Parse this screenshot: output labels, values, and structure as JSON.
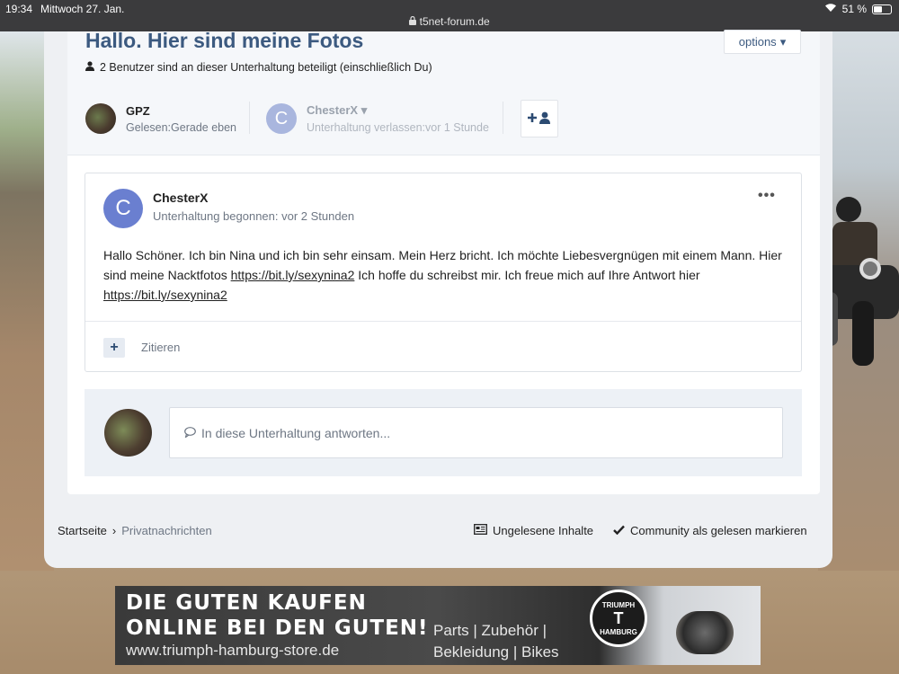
{
  "status": {
    "time": "19:34",
    "date": "Mittwoch 27. Jan.",
    "url": "t5net-forum.de",
    "battery": "51 %"
  },
  "conversation": {
    "title": "Hallo. Hier sind meine Fotos",
    "options_label": "options",
    "participants_note": "2 Benutzer sind an dieser Unterhaltung beteiligt (einschließlich Du)",
    "participants": [
      {
        "name": "GPZ",
        "status": "Gelesen:Gerade eben"
      },
      {
        "name": "ChesterX",
        "initial": "C",
        "status": "Unterhaltung verlassen:vor 1 Stunde"
      }
    ]
  },
  "message": {
    "author": "ChesterX",
    "initial": "C",
    "meta": "Unterhaltung begonnen: vor 2 Stunden",
    "text_1": "Hallo Schöner. Ich bin Nina und ich bin sehr einsam. Mein Herz bricht. Ich möchte Liebesvergnügen mit einem Mann. Hier sind meine Nacktfotos ",
    "link_1": "https://bit.ly/sexynina2",
    "text_2": " Ich hoffe du schreibst mir. Ich freue mich auf Ihre Antwort hier ",
    "link_2": "https://bit.ly/sexynina2",
    "quote_label": "Zitieren"
  },
  "reply": {
    "placeholder": "In diese Unterhaltung antworten..."
  },
  "breadcrumb": {
    "home": "Startseite",
    "current": "Privatnachrichten"
  },
  "footer_actions": {
    "unread": "Ungelesene Inhalte",
    "mark_read": "Community als gelesen markieren"
  },
  "ad": {
    "line1": "DIE GUTEN KAUFEN",
    "line2": "ONLINE BEI DEN GUTEN!",
    "url": "www.triumph-hamburg-store.de",
    "parts_line1": "Parts | Zubehör |",
    "parts_line2": "Bekleidung | Bikes",
    "logo_top": "TRIUMPH",
    "logo_bottom": "HAMBURG"
  },
  "colors": {
    "title": "#3c5a80",
    "accent_avatar": "#6a7fd0"
  }
}
